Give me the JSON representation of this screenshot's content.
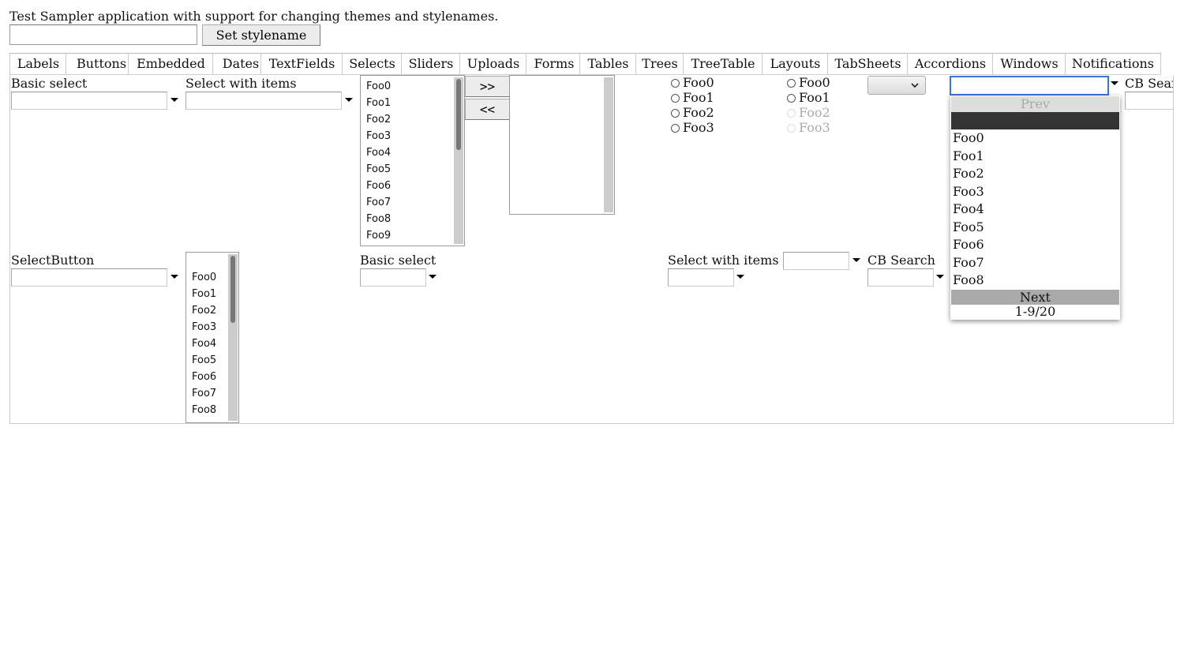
{
  "intro_text": "Test Sampler application with support for changing themes and stylenames.",
  "stylename_input_value": "",
  "set_stylename_label": "Set stylename",
  "tabs": [
    "Labels",
    "Buttons",
    "Embedded",
    "Dates",
    "TextFields",
    "Selects",
    "Sliders",
    "Uploads",
    "Forms",
    "Tables",
    "Trees",
    "TreeTable",
    "Layouts",
    "TabSheets",
    "Accordions",
    "Windows",
    "Notifications"
  ],
  "selects": {
    "basic_select_label": "Basic select",
    "select_with_items_label": "Select with items",
    "listbox_options": [
      "Foo0",
      "Foo1",
      "Foo2",
      "Foo3",
      "Foo4",
      "Foo5",
      "Foo6",
      "Foo7",
      "Foo8",
      "Foo9"
    ],
    "twincol_add_label": ">>",
    "twincol_remove_label": "<<",
    "option_group_1": [
      "Foo0",
      "Foo1",
      "Foo2",
      "Foo3"
    ],
    "option_group_2": [
      "Foo0",
      "Foo1",
      "Foo2",
      "Foo3"
    ],
    "option_group_2_disabled": [
      "Foo2",
      "Foo3"
    ],
    "cb_search_label": "CB Search",
    "select_button_label": "SelectButton",
    "list_select_2_options": [
      "Foo0",
      "Foo1",
      "Foo2",
      "Foo3",
      "Foo4",
      "Foo5",
      "Foo6",
      "Foo7",
      "Foo8"
    ],
    "basic_select_2_label": "Basic select",
    "select_with_items_2_label": "Select with items",
    "cb_search_2_label": "CB Search"
  },
  "popup": {
    "prev_label": "Prev",
    "items": [
      "Foo0",
      "Foo1",
      "Foo2",
      "Foo3",
      "Foo4",
      "Foo5",
      "Foo6",
      "Foo7",
      "Foo8"
    ],
    "next_label": "Next",
    "status": "1-9/20"
  }
}
